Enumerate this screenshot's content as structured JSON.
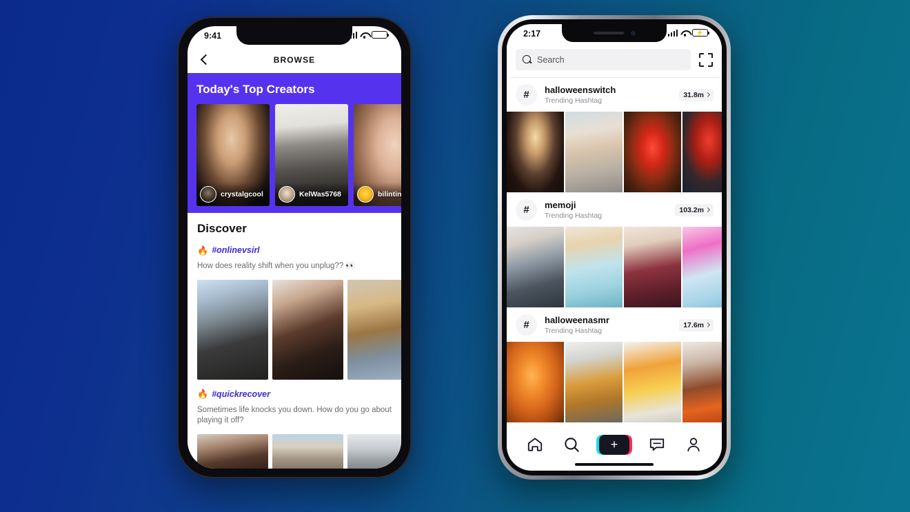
{
  "background": {
    "gradient_from": "#0b2a8c",
    "gradient_to": "#0a7490"
  },
  "phone_left": {
    "status": {
      "time": "9:41",
      "signal": "signal-bars",
      "wifi": "wifi-icon",
      "battery": "battery-full"
    },
    "nav": {
      "back_icon": "chevron-left-icon",
      "title": "BROWSE"
    },
    "top_creators": {
      "heading": "Today's Top Creators",
      "accent": "#5533ee",
      "items": [
        {
          "name": "crystalgcool",
          "avatar": "creator-avatar-1"
        },
        {
          "name": "KelWas5768",
          "avatar": "creator-avatar-2"
        },
        {
          "name": "bilintinama",
          "avatar": "creator-avatar-3"
        }
      ]
    },
    "discover": {
      "heading": "Discover",
      "topics": [
        {
          "flame": "🔥",
          "hashtag": "#onlinevsirl",
          "description": "How does reality shift when you unplug?? 👀",
          "thumbs": [
            "discover-thumb-1",
            "discover-thumb-2",
            "discover-thumb-3"
          ]
        },
        {
          "flame": "🔥",
          "hashtag": "#quickrecover",
          "description": "Sometimes life knocks you down. How do you go about playing it off?",
          "thumbs": [
            "discover-thumb-4",
            "discover-thumb-5",
            "discover-thumb-6"
          ]
        }
      ]
    }
  },
  "phone_right": {
    "status": {
      "time": "2:17",
      "signal": "signal-bars",
      "wifi": "wifi-icon",
      "battery": "battery-charging"
    },
    "search": {
      "placeholder": "Search",
      "icon": "search-icon",
      "scan_icon": "scan-code-icon"
    },
    "hashtags": [
      {
        "symbol": "#",
        "name": "halloweenswitch",
        "subtitle": "Trending Hashtag",
        "count": "31.8m",
        "chevron": "chevron-right-icon",
        "thumbs": [
          "halloweenswitch-thumb-1",
          "halloweenswitch-thumb-2",
          "halloweenswitch-thumb-3",
          "halloweenswitch-thumb-4"
        ]
      },
      {
        "symbol": "#",
        "name": "memoji",
        "subtitle": "Trending Hashtag",
        "count": "103.2m",
        "chevron": "chevron-right-icon",
        "thumbs": [
          "memoji-thumb-1",
          "memoji-thumb-2",
          "memoji-thumb-3",
          "memoji-thumb-4"
        ]
      },
      {
        "symbol": "#",
        "name": "halloweenasmr",
        "subtitle": "Trending Hashtag",
        "count": "17.6m",
        "chevron": "chevron-right-icon",
        "thumbs": [
          "halloweenasmr-thumb-1",
          "halloweenasmr-thumb-2",
          "halloweenasmr-thumb-3",
          "halloweenasmr-thumb-4"
        ]
      }
    ],
    "tabbar": {
      "items": [
        {
          "icon": "home-icon",
          "label": "Home"
        },
        {
          "icon": "search-icon",
          "label": "Discover"
        },
        {
          "icon": "plus-icon",
          "label": "Create"
        },
        {
          "icon": "inbox-icon",
          "label": "Inbox"
        },
        {
          "icon": "person-icon",
          "label": "Profile"
        }
      ],
      "create_colors": {
        "left": "#22d7e8",
        "right": "#fe2c55",
        "center": "#161622"
      },
      "create_symbol": "+"
    }
  }
}
